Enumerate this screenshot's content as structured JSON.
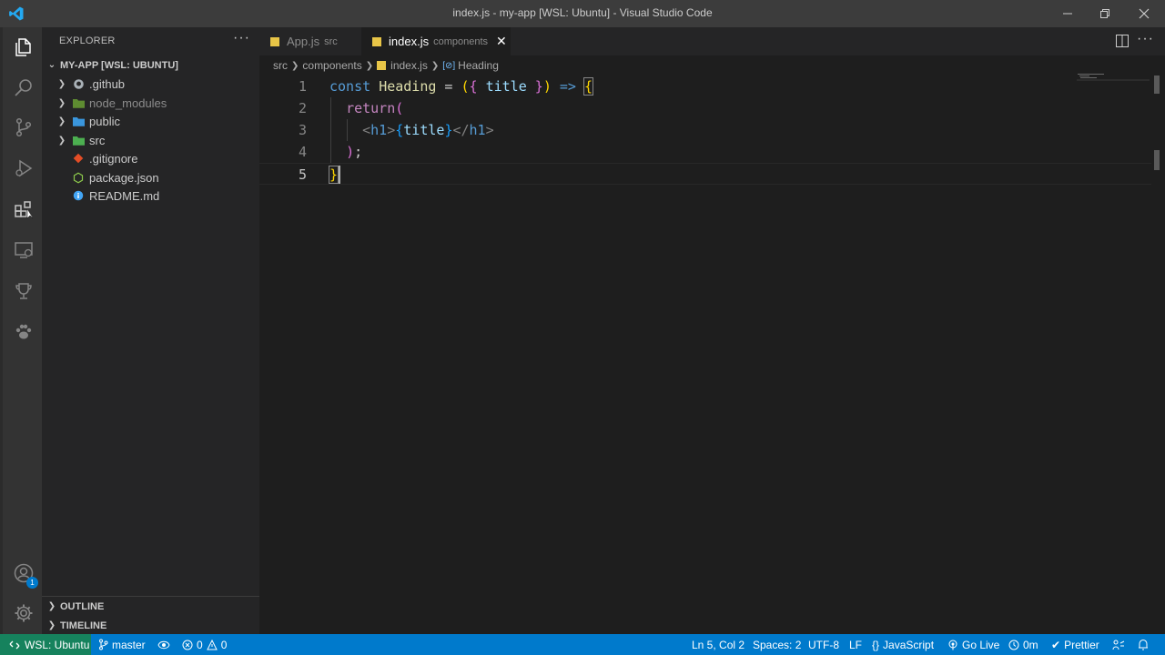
{
  "window": {
    "title": "index.js - my-app [WSL: Ubuntu] - Visual Studio Code"
  },
  "activity_bar": {
    "items": [
      "explorer",
      "search",
      "source-control",
      "run-debug",
      "extensions",
      "remote-explorer",
      "trophy",
      "paw"
    ],
    "accounts_badge": "1"
  },
  "sidebar": {
    "header": "EXPLORER",
    "root": "MY-APP [WSL: UBUNTU]",
    "items": [
      {
        "label": ".github",
        "type": "folder"
      },
      {
        "label": "node_modules",
        "type": "folder"
      },
      {
        "label": "public",
        "type": "folder"
      },
      {
        "label": "src",
        "type": "folder"
      },
      {
        "label": ".gitignore",
        "type": "file"
      },
      {
        "label": "package.json",
        "type": "file"
      },
      {
        "label": "README.md",
        "type": "file"
      }
    ],
    "outline": "OUTLINE",
    "timeline": "TIMELINE"
  },
  "tabs": [
    {
      "label": "App.js",
      "desc": "src",
      "active": false
    },
    {
      "label": "index.js",
      "desc": "components",
      "active": true
    }
  ],
  "breadcrumbs": [
    "src",
    "components",
    "index.js",
    "Heading"
  ],
  "editor": {
    "line_numbers": [
      "1",
      "2",
      "3",
      "4",
      "5"
    ],
    "current_line": 5
  },
  "statusbar": {
    "remote": "WSL: Ubuntu",
    "branch": "master",
    "errors": "0",
    "warnings": "0",
    "position": "Ln 5, Col 2",
    "spaces": "Spaces: 2",
    "encoding": "UTF-8",
    "eol": "LF",
    "language": "JavaScript",
    "golive": "Go Live",
    "time": "0m",
    "prettier": "Prettier"
  },
  "colors": {
    "accent": "#007acc",
    "remote": "#16825d",
    "js": "#e8c547"
  }
}
